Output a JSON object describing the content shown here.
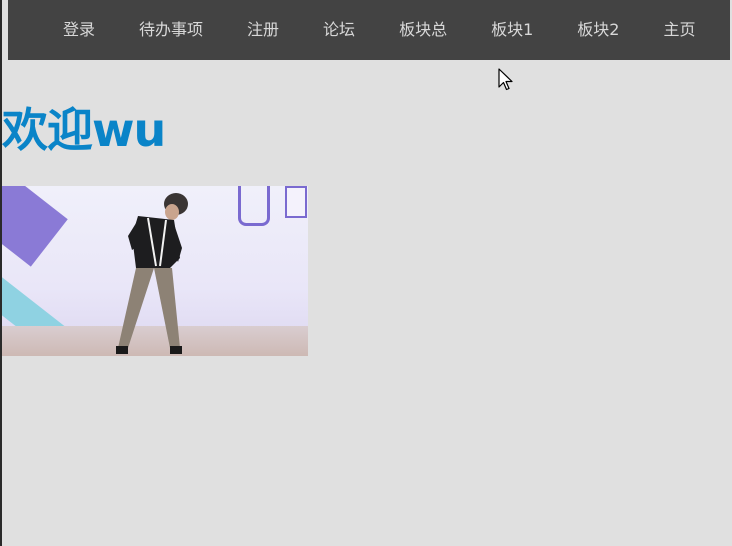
{
  "nav": {
    "items": [
      {
        "label": "登录"
      },
      {
        "label": "待办事项"
      },
      {
        "label": "注册"
      },
      {
        "label": "论坛"
      },
      {
        "label": "板块总"
      },
      {
        "label": "板块1"
      },
      {
        "label": "板块2"
      },
      {
        "label": "主页"
      }
    ]
  },
  "main": {
    "welcome_text": "欢迎wu"
  },
  "colors": {
    "navbar_bg": "#434343",
    "page_bg": "#e0e0e0",
    "welcome_color": "#0a84c8",
    "nav_text": "#d8d8d8"
  }
}
